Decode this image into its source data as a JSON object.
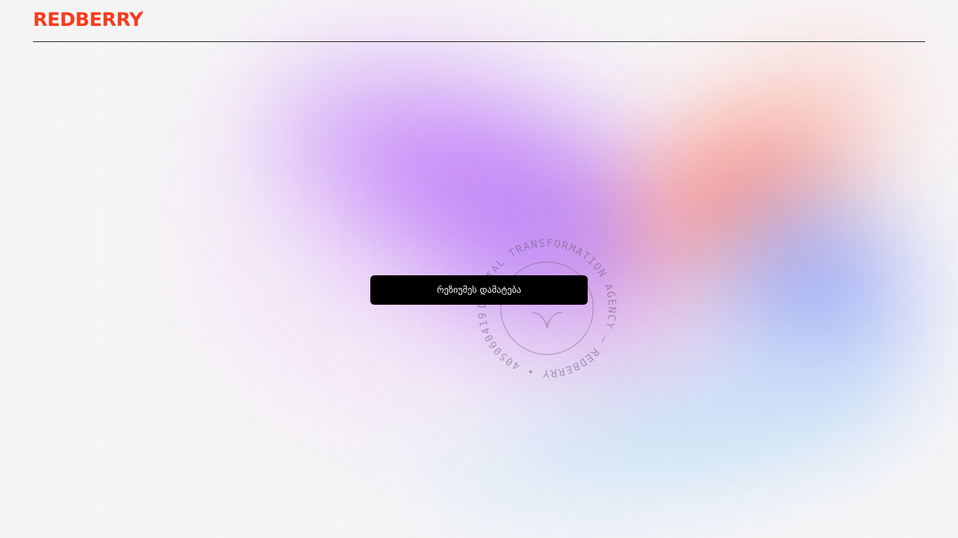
{
  "brand": {
    "logo_text": "REDBERRY",
    "trademark": "®",
    "color": "#f93b1d"
  },
  "main": {
    "add_resume_label": "რეზიუმეს დამატება"
  },
  "stamp": {
    "ring_text": "DIGITAL TRANSFORMATION AGENCY — REDBERRY • 405060419 •"
  },
  "colors": {
    "background": "#f7f6f7",
    "button_bg": "#000000",
    "button_text": "#ffffff",
    "divider": "#1a1a1a"
  },
  "icons": {
    "stamp_center": "berry-leaf-icon"
  }
}
